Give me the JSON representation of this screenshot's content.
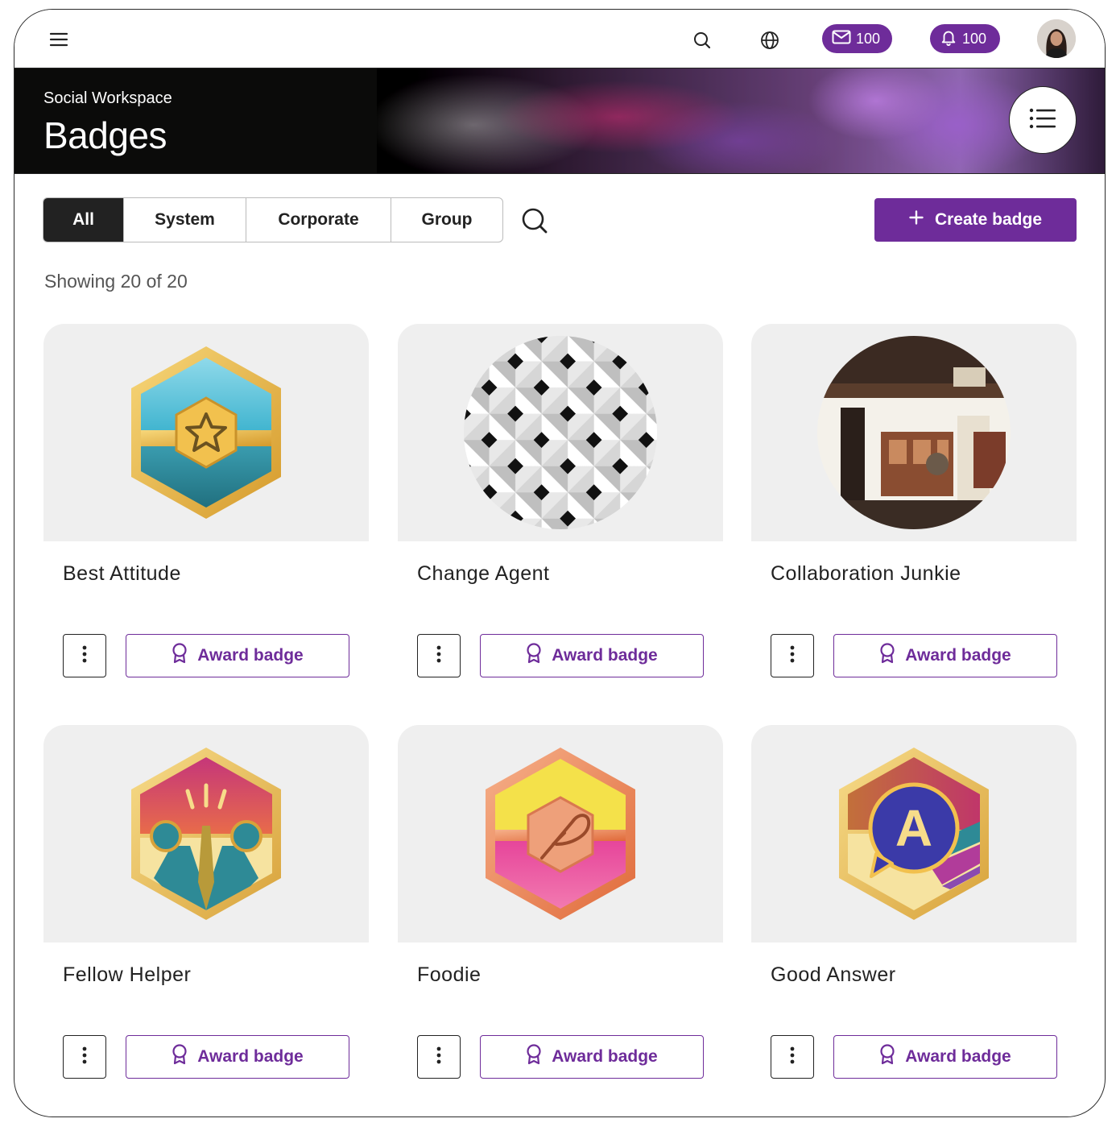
{
  "topbar": {
    "mail_count": "100",
    "notification_count": "100"
  },
  "banner": {
    "subtitle": "Social Workspace",
    "title": "Badges"
  },
  "filters": {
    "tabs": [
      {
        "label": "All",
        "active": true
      },
      {
        "label": "System",
        "active": false
      },
      {
        "label": "Corporate",
        "active": false
      },
      {
        "label": "Group",
        "active": false
      }
    ],
    "create_label": "Create badge"
  },
  "results": {
    "showing_text": "Showing 20 of 20"
  },
  "badges": [
    {
      "name": "Best Attitude",
      "award_label": "Award badge"
    },
    {
      "name": "Change Agent",
      "award_label": "Award badge"
    },
    {
      "name": "Collaboration Junkie",
      "award_label": "Award badge"
    },
    {
      "name": "Fellow Helper",
      "award_label": "Award badge"
    },
    {
      "name": "Foodie",
      "award_label": "Award badge"
    },
    {
      "name": "Good Answer",
      "award_label": "Award badge"
    }
  ],
  "colors": {
    "accent": "#6e2c9a",
    "dark": "#222222",
    "card_bg": "#efefef"
  },
  "icons": [
    "menu-icon",
    "search-icon",
    "globe-icon",
    "mail-icon",
    "bell-icon",
    "list-icon",
    "plus-icon",
    "kebab-icon",
    "ribbon-icon"
  ]
}
